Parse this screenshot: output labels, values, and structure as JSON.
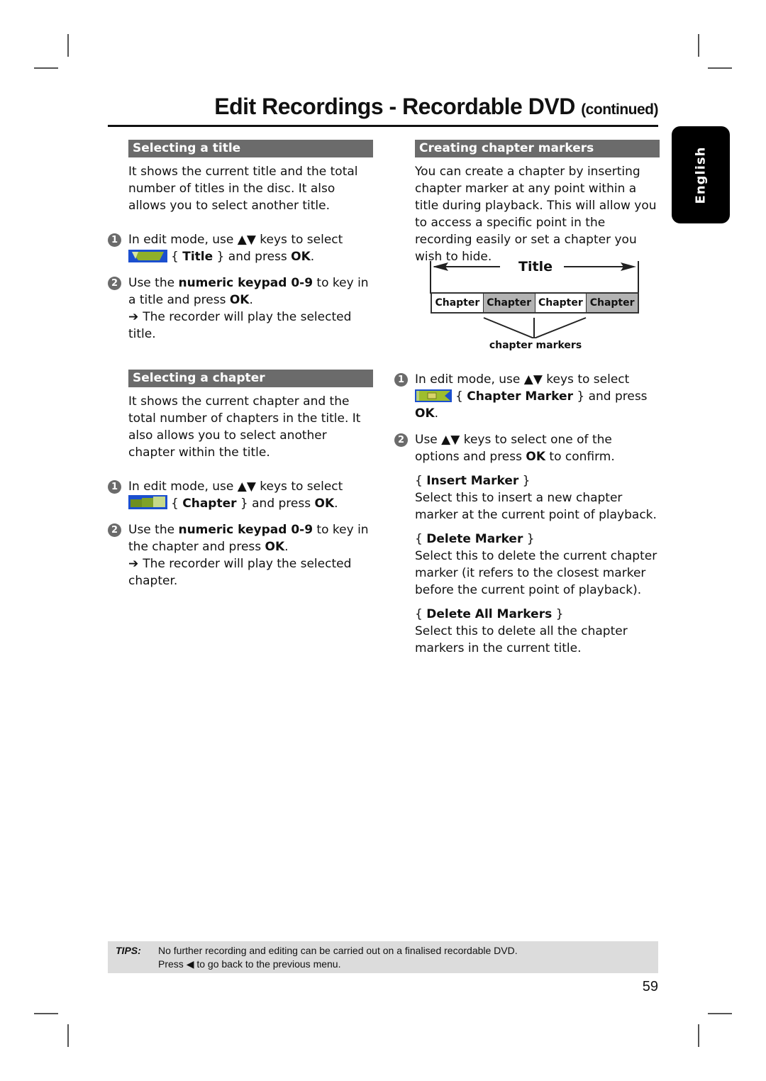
{
  "header": {
    "title": "Edit Recordings - Recordable DVD",
    "continued": "(continued)"
  },
  "language_tab": "English",
  "left": {
    "select_title": {
      "heading": "Selecting a title",
      "intro": "It shows the current title and the total number of titles in the disc. It also allows you to select another title.",
      "step1": {
        "num": "1",
        "pre": "In edit mode, use ▲▼ keys to select",
        "icon": "title-icon",
        "brace_open": "{ ",
        "option": "Title",
        "brace_close": " } and press ",
        "ok": "OK",
        "end": "."
      },
      "step2": {
        "num": "2",
        "pre": "Use the ",
        "keypad": "numeric keypad 0-9",
        "mid": " to key in a title and press ",
        "ok": "OK",
        "end": ".",
        "result_arrow": "➔",
        "result": "The recorder will play the selected title."
      }
    },
    "select_chapter": {
      "heading": "Selecting a chapter",
      "intro": "It shows the current chapter and the total number of chapters in the title. It also allows you to select another chapter within the title.",
      "step1": {
        "num": "1",
        "pre": "In edit mode, use ▲▼ keys to select",
        "icon": "chapter-icon",
        "brace_open": "{ ",
        "option": "Chapter",
        "brace_close": " } and press ",
        "ok": "OK",
        "end": "."
      },
      "step2": {
        "num": "2",
        "pre": "Use the ",
        "keypad": "numeric keypad 0-9",
        "mid": " to key in the chapter and press ",
        "ok": "OK",
        "end": ".",
        "result_arrow": "➔",
        "result": "The recorder will play the selected chapter."
      }
    }
  },
  "right": {
    "heading": "Creating chapter markers",
    "intro": "You can create a chapter by inserting chapter marker at any point within a title during playback. This will allow you to access a specific point in the recording easily or set a chapter you wish to hide.",
    "diagram": {
      "title": "Title",
      "chapters": [
        "Chapter",
        "Chapter",
        "Chapter",
        "Chapter"
      ],
      "label": "chapter markers"
    },
    "step1": {
      "num": "1",
      "pre": "In edit mode, use ▲▼ keys to select",
      "icon": "chapter-marker-icon",
      "brace_open": "{ ",
      "option": "Chapter Marker",
      "brace_close": " } and press ",
      "ok": "OK",
      "end": "."
    },
    "step2": {
      "num": "2",
      "pre": "Use ▲▼ keys to select one of the options and press ",
      "ok": "OK",
      "end": " to confirm."
    },
    "options": [
      {
        "name": "Insert Marker",
        "desc": "Select this to insert a new chapter marker at the current point of playback."
      },
      {
        "name": "Delete Marker",
        "desc": "Select this to delete the current chapter marker (it refers to the closest marker before the current point of playback)."
      },
      {
        "name": "Delete All Markers",
        "desc": "Select this to delete all the chapter markers in the current title."
      }
    ]
  },
  "tips": {
    "label": "TIPS:",
    "line1": "No further recording and editing can be carried out on a finalised recordable DVD.",
    "line2_pre": "Press ",
    "line2_icon": "◀",
    "line2_post": " to go back to the previous menu."
  },
  "page_number": "59"
}
